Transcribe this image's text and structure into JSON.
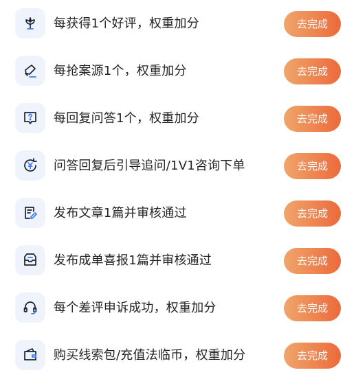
{
  "colors": {
    "icon_bg": "#eef3fc",
    "icon_stroke": "#1b2233",
    "icon_accent": "#3b7cf5",
    "button_gradient_start": "#f0a56b",
    "button_gradient_end": "#ec6a3c"
  },
  "tasks": [
    {
      "icon": "flower-icon",
      "label": "每获得1个好评，权重加分",
      "button": "去完成"
    },
    {
      "icon": "pen-icon",
      "label": "每抢案源1个，权重加分",
      "button": "去完成"
    },
    {
      "icon": "question-bubble-icon",
      "label": "每回复问答1个，权重加分",
      "button": "去完成"
    },
    {
      "icon": "yuan-refresh-icon",
      "label": "问答回复后引导追问/1V1咨询下单",
      "button": "去完成"
    },
    {
      "icon": "edit-document-icon",
      "label": "发布文章1篇并审核通过",
      "button": "去完成"
    },
    {
      "icon": "inbox-icon",
      "label": "发布成单喜报1篇并审核通过",
      "button": "去完成"
    },
    {
      "icon": "headset-icon",
      "label": "每个差评申诉成功，权重加分",
      "button": "去完成"
    },
    {
      "icon": "wallet-icon",
      "label": "购买线索包/充值法临币，权重加分",
      "button": "去完成"
    }
  ]
}
